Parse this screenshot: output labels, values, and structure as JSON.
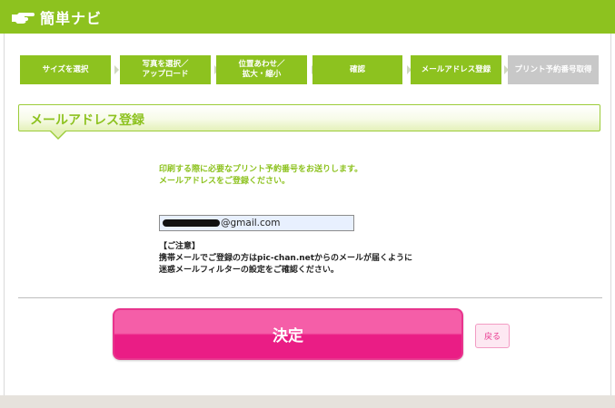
{
  "header": {
    "title": "簡単ナビ",
    "icon": "pointing-hand-icon"
  },
  "steps": [
    {
      "label": "サイズを選択",
      "active": true
    },
    {
      "label": "写真を選択／\nアップロード",
      "active": true
    },
    {
      "label": "位置あわせ／\n拡大・縮小",
      "active": true
    },
    {
      "label": "確認",
      "active": true
    },
    {
      "label": "メールアドレス登録",
      "active": true
    },
    {
      "label": "プリント予約番号取得",
      "active": false
    }
  ],
  "section": {
    "title": "メールアドレス登録"
  },
  "intro": {
    "line1": "印刷する際に必要なプリント予約番号をお送りします。",
    "line2": "メールアドレスをご登録ください。"
  },
  "email_field": {
    "value_visible": "@gmail.com"
  },
  "notice": {
    "heading": "【ご注意】",
    "line1": "携帯メールでご登録の方はpic-chan.netからのメールが届くように",
    "line2": "迷惑メールフィルターの設定をご確認ください。"
  },
  "buttons": {
    "submit": "決定",
    "back": "戻る"
  },
  "colors": {
    "brand_green": "#8dc21f",
    "step_disabled": "#c8c8c8",
    "submit_pink": "#ea1d85",
    "email_bg": "#e8f0fe"
  }
}
